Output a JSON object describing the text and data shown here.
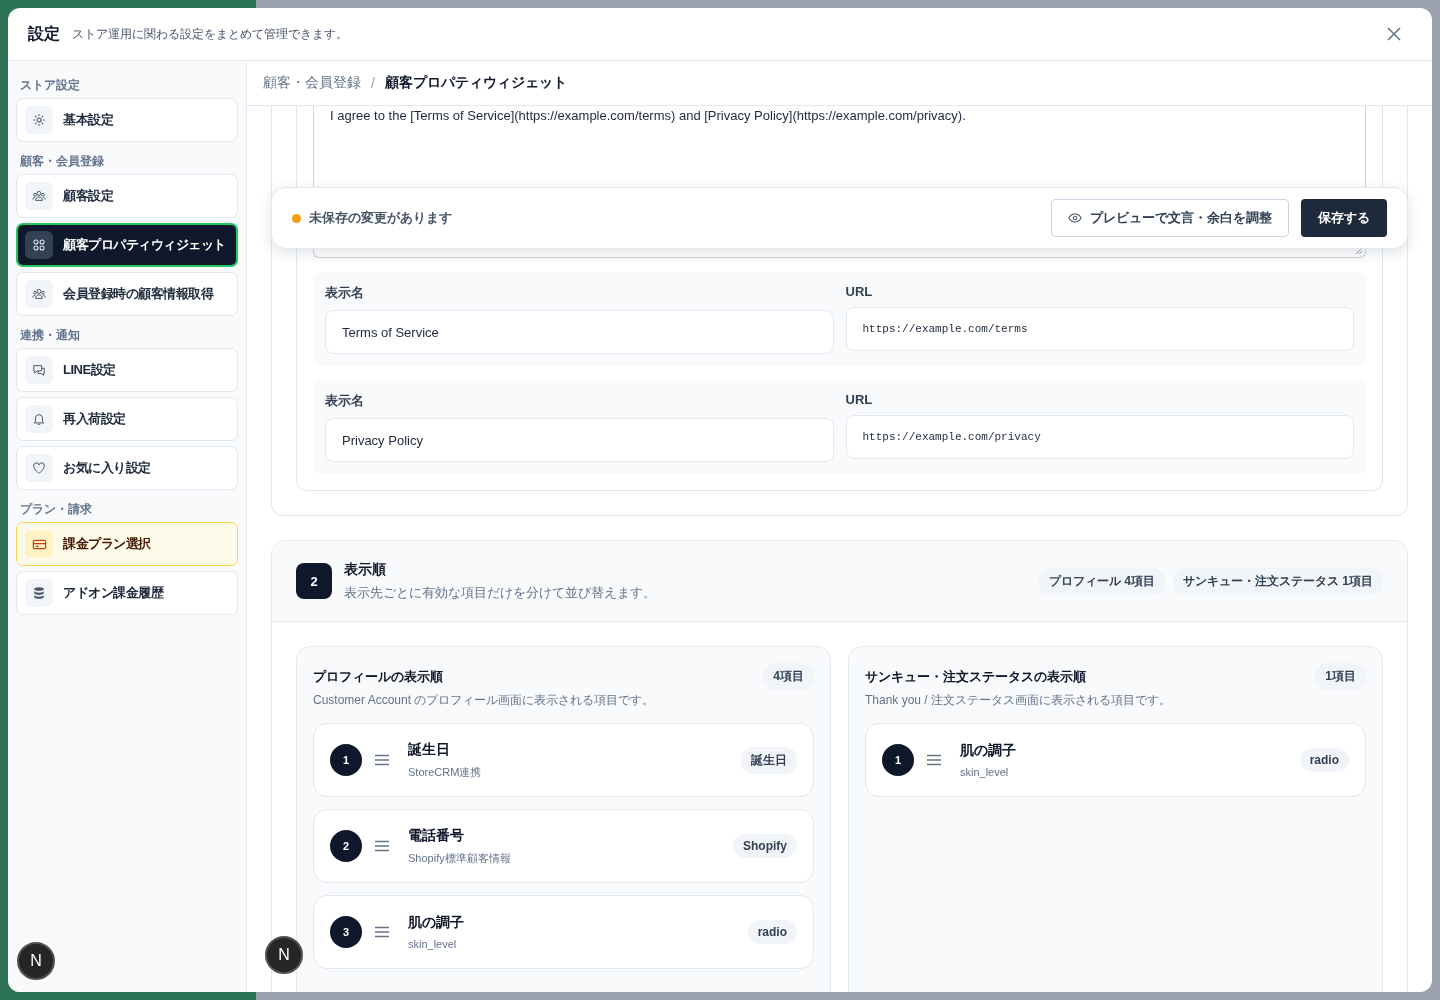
{
  "header": {
    "title": "設定",
    "subtitle": "ストア運用に関わる設定をまとめて管理できます。"
  },
  "sidebar": {
    "groups": [
      {
        "label": "ストア設定",
        "items": [
          {
            "label": "基本設定",
            "kind": "normal",
            "selected": false
          }
        ]
      },
      {
        "label": "顧客・会員登録",
        "items": [
          {
            "label": "顧客設定",
            "kind": "normal",
            "selected": false
          },
          {
            "label": "顧客プロパティウィジェット",
            "kind": "normal",
            "selected": true
          },
          {
            "label": "会員登録時の顧客情報取得",
            "kind": "normal",
            "selected": false
          }
        ]
      },
      {
        "label": "連携・通知",
        "items": [
          {
            "label": "LINE設定",
            "kind": "normal",
            "selected": false
          },
          {
            "label": "再入荷設定",
            "kind": "normal",
            "selected": false
          },
          {
            "label": "お気に入り設定",
            "kind": "normal",
            "selected": false
          }
        ]
      },
      {
        "label": "プラン・請求",
        "items": [
          {
            "label": "課金プラン選択",
            "kind": "plan",
            "selected": false
          },
          {
            "label": "アドオン課金履歴",
            "kind": "normal",
            "selected": false
          }
        ]
      }
    ]
  },
  "breadcrumb": [
    "顧客・会員登録",
    "顧客プロパティウィジェット"
  ],
  "breadcrumb_separator": "/",
  "terms_card": {
    "consent_text": "I agree to the [Terms of Service](https://example.com/terms) and [Privacy Policy](https://example.com/privacy).",
    "links": [
      {
        "name_label": "表示名",
        "name": "Terms of Service",
        "url_label": "URL",
        "url": "https://example.com/terms"
      },
      {
        "name_label": "表示名",
        "name": "Privacy Policy",
        "url_label": "URL",
        "url": "https://example.com/privacy"
      }
    ]
  },
  "unsaved_bar": {
    "message": "未保存の変更があります",
    "preview_button": "プレビューで文言・余白を調整",
    "save_button": "保存する"
  },
  "order_section": {
    "step": "2",
    "title": "表示順",
    "description": "表示先ごとに有効な項目だけを分けて並び替えます。",
    "badges": [
      "プロフィール 4項目",
      "サンキュー・注文ステータス 1項目"
    ],
    "panels": [
      {
        "title": "プロフィールの表示順",
        "count": "4項目",
        "description": "Customer Account のプロフィール画面に表示される項目です。",
        "items": [
          {
            "number": "1",
            "name": "誕生日",
            "source": "StoreCRM連携",
            "tag": "誕生日"
          },
          {
            "number": "2",
            "name": "電話番号",
            "source": "Shopify標準顧客情報",
            "tag": "Shopify"
          },
          {
            "number": "3",
            "name": "肌の調子",
            "source": "skin_level",
            "tag": "radio"
          }
        ]
      },
      {
        "title": "サンキュー・注文ステータスの表示順",
        "count": "1項目",
        "description": "Thank you / 注文ステータス画面に表示される項目です。",
        "items": [
          {
            "number": "1",
            "name": "肌の調子",
            "source": "skin_level",
            "tag": "radio"
          }
        ]
      }
    ]
  },
  "dev_indicators": [
    "N",
    "N"
  ]
}
